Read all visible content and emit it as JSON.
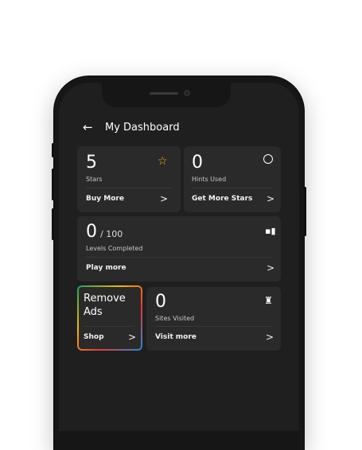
{
  "header": {
    "back_icon": "arrow-left-icon",
    "title": "My Dashboard"
  },
  "stars": {
    "value": "5",
    "label": "Stars",
    "icon": "star-icon",
    "action": "Buy More",
    "chevron": ">"
  },
  "hints": {
    "value": "0",
    "label": "Hints Used",
    "icon": "clock-icon",
    "action": "Get More Stars",
    "chevron": ">"
  },
  "levels": {
    "value": "0",
    "total": "/ 100",
    "label": "Levels Completed",
    "icon": "chart-icon",
    "action": "Play more",
    "chevron": ">"
  },
  "remove_ads": {
    "line1": "Remove",
    "line2": "Ads",
    "action": "Shop",
    "chevron": ">"
  },
  "sites": {
    "value": "0",
    "label": "Sites Visited",
    "icon": "trophy-icon",
    "action": "Visit more",
    "chevron": ">"
  },
  "colors": {
    "accent_star": "#f5b400",
    "card": "#2a2a2a",
    "screen": "#1f1f1f"
  }
}
